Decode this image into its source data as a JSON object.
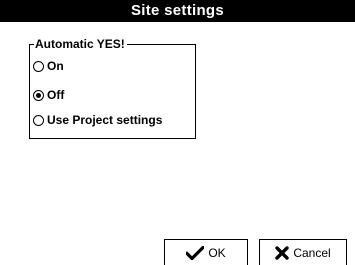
{
  "window": {
    "title": "Site settings"
  },
  "group": {
    "legend": "Automatic YES!",
    "options": [
      {
        "label": "On",
        "selected": false
      },
      {
        "label": "Off",
        "selected": true
      },
      {
        "label": "Use Project settings",
        "selected": false
      }
    ]
  },
  "buttons": {
    "ok_label": "OK",
    "ok_icon": "checkmark-icon",
    "cancel_label": "Cancel",
    "cancel_icon": "cross-icon"
  },
  "colors": {
    "title_bg": "#000000",
    "title_fg": "#ffffff",
    "background": "#ffffff"
  }
}
